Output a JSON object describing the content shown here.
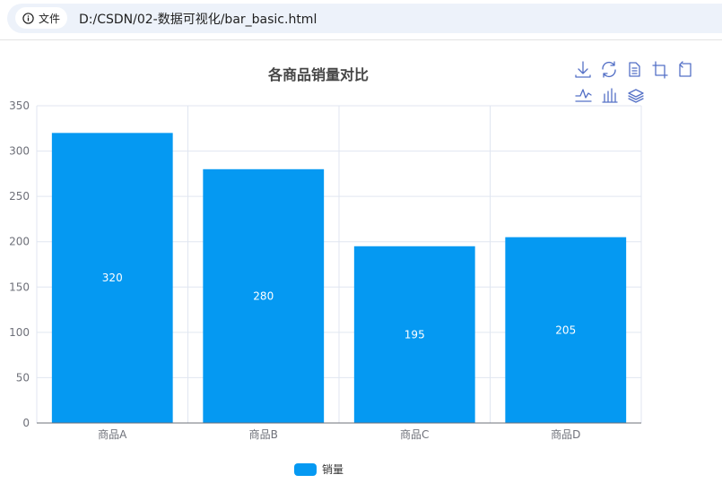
{
  "browser": {
    "site_info_label": "文件",
    "url": "D:/CSDN/02-数据可视化/bar_basic.html"
  },
  "toolbox": {
    "items": [
      "download-icon",
      "refresh-icon",
      "data-view-icon",
      "zoom-icon",
      "zoom-reset-icon",
      "line-chart-icon",
      "bar-chart-icon",
      "stack-icon"
    ]
  },
  "colors": {
    "bar": "#0599f2",
    "axis": "#6e7079",
    "grid": "#e0e6f1",
    "title": "#464646"
  },
  "chart_data": {
    "type": "bar",
    "title": "各商品销量对比",
    "categories": [
      "商品A",
      "商品B",
      "商品C",
      "商品D"
    ],
    "series": [
      {
        "name": "销量",
        "values": [
          320,
          280,
          195,
          205
        ]
      }
    ],
    "ylim": [
      0,
      350
    ],
    "yticks": [
      0,
      50,
      100,
      150,
      200,
      250,
      300,
      350
    ],
    "data_labels": true,
    "grid": true,
    "legend": "bottom-center"
  }
}
